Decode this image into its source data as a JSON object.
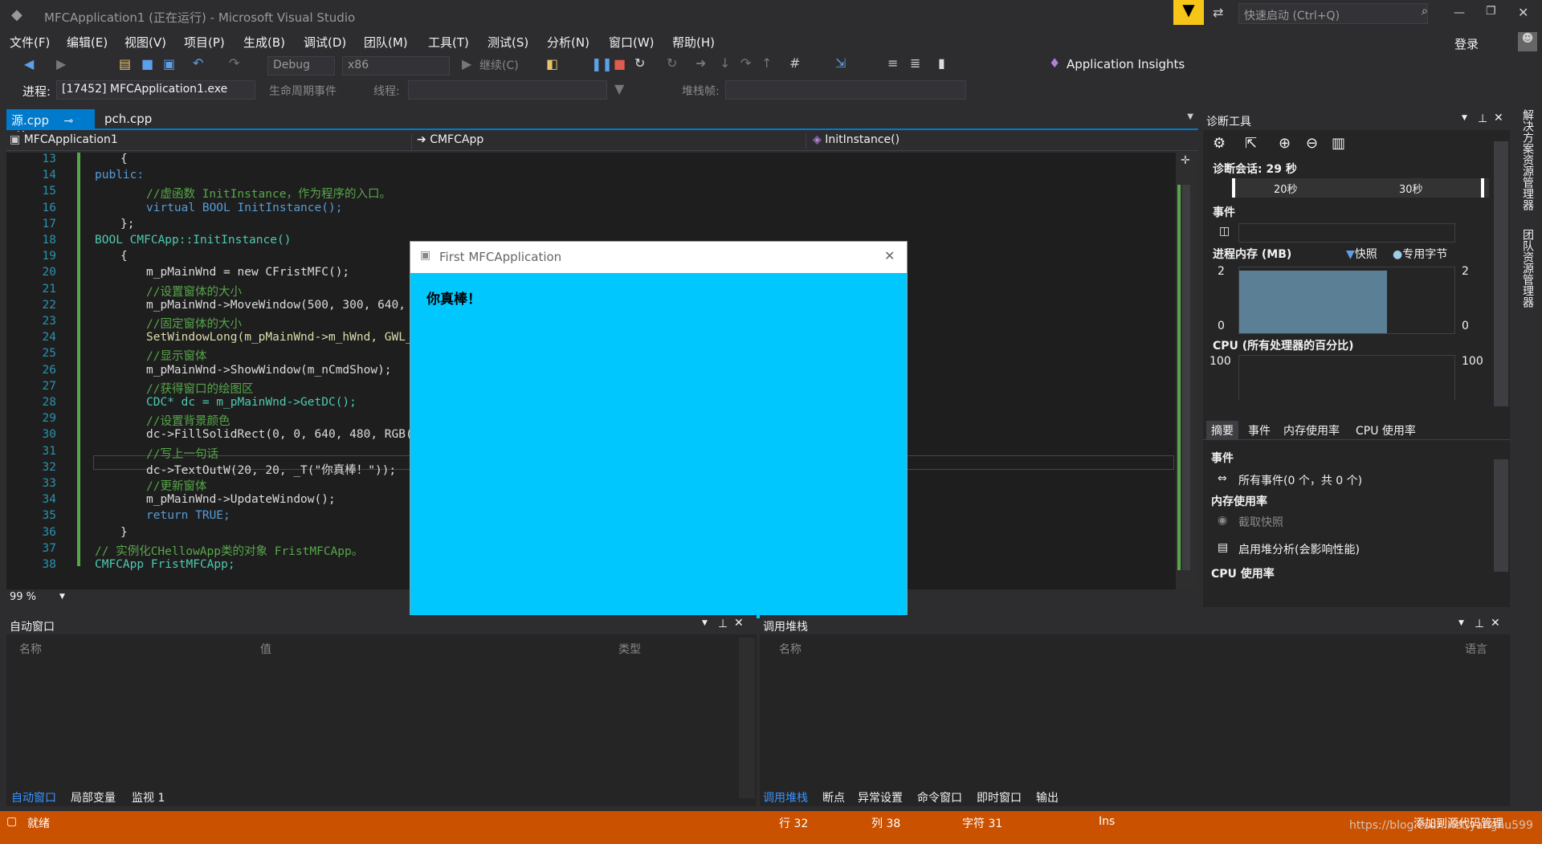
{
  "window": {
    "title": "MFCApplication1 (正在运行) - Microsoft Visual Studio",
    "quick_launch": "快速启动 (Ctrl+Q)",
    "login": "登录"
  },
  "menu": [
    "文件(F)",
    "编辑(E)",
    "视图(V)",
    "项目(P)",
    "生成(B)",
    "调试(D)",
    "团队(M)",
    "工具(T)",
    "测试(S)",
    "分析(N)",
    "窗口(W)",
    "帮助(H)"
  ],
  "toolbar": {
    "config": "Debug",
    "platform": "x86",
    "continue": "继续(C)",
    "app_insights": "Application Insights",
    "process_label": "进程:",
    "process": "[17452] MFCApplication1.exe",
    "lifecycle": "生命周期事件",
    "thread_label": "线程:",
    "stack_label": "堆栈帧:"
  },
  "editor": {
    "tabs": [
      "源.cpp",
      "pch.cpp"
    ],
    "nav_project": "MFCApplication1",
    "nav_class": "CMFCApp",
    "nav_member": "InitInstance()",
    "zoom": "99 %"
  },
  "code_lines": [
    {
      "n": "13",
      "t": "{"
    },
    {
      "n": "14",
      "t": "public:"
    },
    {
      "n": "15",
      "t": "//虚函数 InitInstance，作为程序的入口。"
    },
    {
      "n": "16",
      "t": "virtual BOOL InitInstance();"
    },
    {
      "n": "17",
      "t": "};"
    },
    {
      "n": "18",
      "t": "BOOL CMFCApp::InitInstance()"
    },
    {
      "n": "19",
      "t": "{"
    },
    {
      "n": "20",
      "t": "m_pMainWnd = new CFristMFC();"
    },
    {
      "n": "21",
      "t": "//设置窗体的大小"
    },
    {
      "n": "22",
      "t": "m_pMainWnd->MoveWindow(500, 300, 640, 480, FA"
    },
    {
      "n": "23",
      "t": "//固定窗体的大小"
    },
    {
      "n": "24",
      "t": "SetWindowLong(m_pMainWnd->m_hWnd, GWL_STYLE,"
    },
    {
      "n": "25",
      "t": "//显示窗体"
    },
    {
      "n": "26",
      "t": "m_pMainWnd->ShowWindow(m_nCmdShow);"
    },
    {
      "n": "27",
      "t": "//获得窗口的绘图区"
    },
    {
      "n": "28",
      "t": "CDC* dc = m_pMainWnd->GetDC();"
    },
    {
      "n": "29",
      "t": "//设置背景颜色"
    },
    {
      "n": "30",
      "t": "dc->FillSolidRect(0, 0, 640, 480, RGB(0, 200,"
    },
    {
      "n": "31",
      "t": "//写上一句话"
    },
    {
      "n": "32",
      "t": "dc->TextOutW(20, 20, _T(\"你真棒！\"));"
    },
    {
      "n": "33",
      "t": "//更新窗体"
    },
    {
      "n": "34",
      "t": "m_pMainWnd->UpdateWindow();"
    },
    {
      "n": "35",
      "t": "return TRUE;"
    },
    {
      "n": "36",
      "t": "}"
    },
    {
      "n": "37",
      "t": "// 实例化CHellowApp类的对象 FristMFCApp。"
    },
    {
      "n": "38",
      "t": "CMFCApp FristMFCApp;"
    }
  ],
  "dialog": {
    "title": "First MFCApplication",
    "text": "你真棒！",
    "bg": "#00c8ff"
  },
  "diag": {
    "title": "诊断工具",
    "session": "诊断会话: 29 秒",
    "t1": "20秒",
    "t2": "30秒",
    "events": "事件",
    "memory": "进程内存 (MB)",
    "snapshot": "快照",
    "private": "专用字节",
    "mem_max": "2",
    "mem_min": "0",
    "cpu": "CPU (所有处理器的百分比)",
    "cpu_max": "100",
    "tabs": [
      "摘要",
      "事件",
      "内存使用率",
      "CPU 使用率"
    ],
    "sec_events": "事件",
    "all_events": "所有事件(0 个，共 0 个)",
    "sec_mem": "内存使用率",
    "take_snapshot": "截取快照",
    "heap": "启用堆分析(会影响性能)",
    "sec_cpu": "CPU 使用率"
  },
  "side_tabs": [
    "解决方案资源管理器",
    "团队资源管理器"
  ],
  "autos": {
    "title": "自动窗口",
    "cols": [
      "名称",
      "值",
      "类型"
    ],
    "tabs": [
      "自动窗口",
      "局部变量",
      "监视 1"
    ]
  },
  "callstack": {
    "title": "调用堆栈",
    "cols": [
      "名称",
      "语言"
    ],
    "tabs": [
      "调用堆栈",
      "断点",
      "异常设置",
      "命令窗口",
      "即时窗口",
      "输出"
    ]
  },
  "status": {
    "ready": "就绪",
    "line": "行 32",
    "col": "列 38",
    "ch": "字符 31",
    "ins": "Ins",
    "add_src": "添加到源代码管理",
    "watermark": "https://blog.csdn.net/yangnu599",
    "color": "#ca5100"
  }
}
